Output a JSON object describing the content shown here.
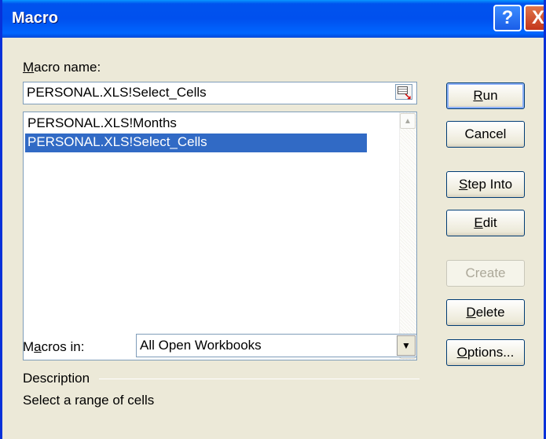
{
  "window": {
    "title": "Macro"
  },
  "titlebar_buttons": {
    "help": "?",
    "close": "X"
  },
  "macro_name": {
    "label_accel": "M",
    "label_rest": "acro name:",
    "value": "PERSONAL.XLS!Select_Cells"
  },
  "macro_list": {
    "items": [
      {
        "label": "PERSONAL.XLS!Months",
        "selected": false
      },
      {
        "label": "PERSONAL.XLS!Select_Cells",
        "selected": true
      }
    ]
  },
  "macros_in": {
    "label_pre": "M",
    "label_accel": "a",
    "label_rest": "cros in:",
    "selected": "All Open Workbooks"
  },
  "description": {
    "label": "Description",
    "text": "Select a range of cells"
  },
  "buttons": {
    "run": {
      "accel": "R",
      "rest": "un"
    },
    "cancel": {
      "label": "Cancel"
    },
    "step_into": {
      "accel": "S",
      "rest": "tep Into"
    },
    "edit": {
      "accel": "E",
      "rest": "dit"
    },
    "create": {
      "label": "Create"
    },
    "delete": {
      "accel": "D",
      "rest": "elete"
    },
    "options": {
      "accel": "O",
      "rest": "ptions..."
    }
  },
  "colors": {
    "titlebar": "#0053ee",
    "dialog_bg": "#ece9d8",
    "selection": "#316ac5"
  }
}
